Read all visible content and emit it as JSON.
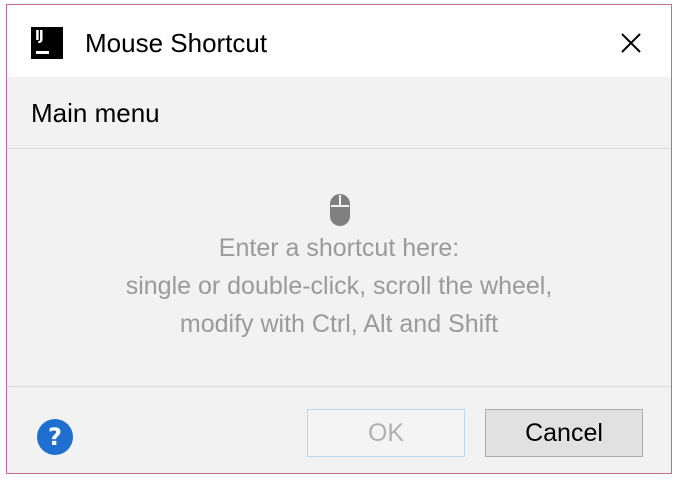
{
  "window": {
    "title": "Mouse Shortcut",
    "app_icon": "intellij-icon",
    "app_icon_text": "IJ"
  },
  "section": {
    "title": "Main menu"
  },
  "capture": {
    "icon": "mouse-icon",
    "hint_lines": [
      "Enter a shortcut here:",
      "single or double-click, scroll the wheel,",
      "modify with Ctrl, Alt and Shift"
    ]
  },
  "footer": {
    "help_label": "?",
    "ok_label": "OK",
    "cancel_label": "Cancel",
    "ok_enabled": false
  },
  "colors": {
    "border_accent": "#c46a92",
    "help_blue": "#1e6fcf",
    "hint_gray": "#9a9a9a"
  }
}
